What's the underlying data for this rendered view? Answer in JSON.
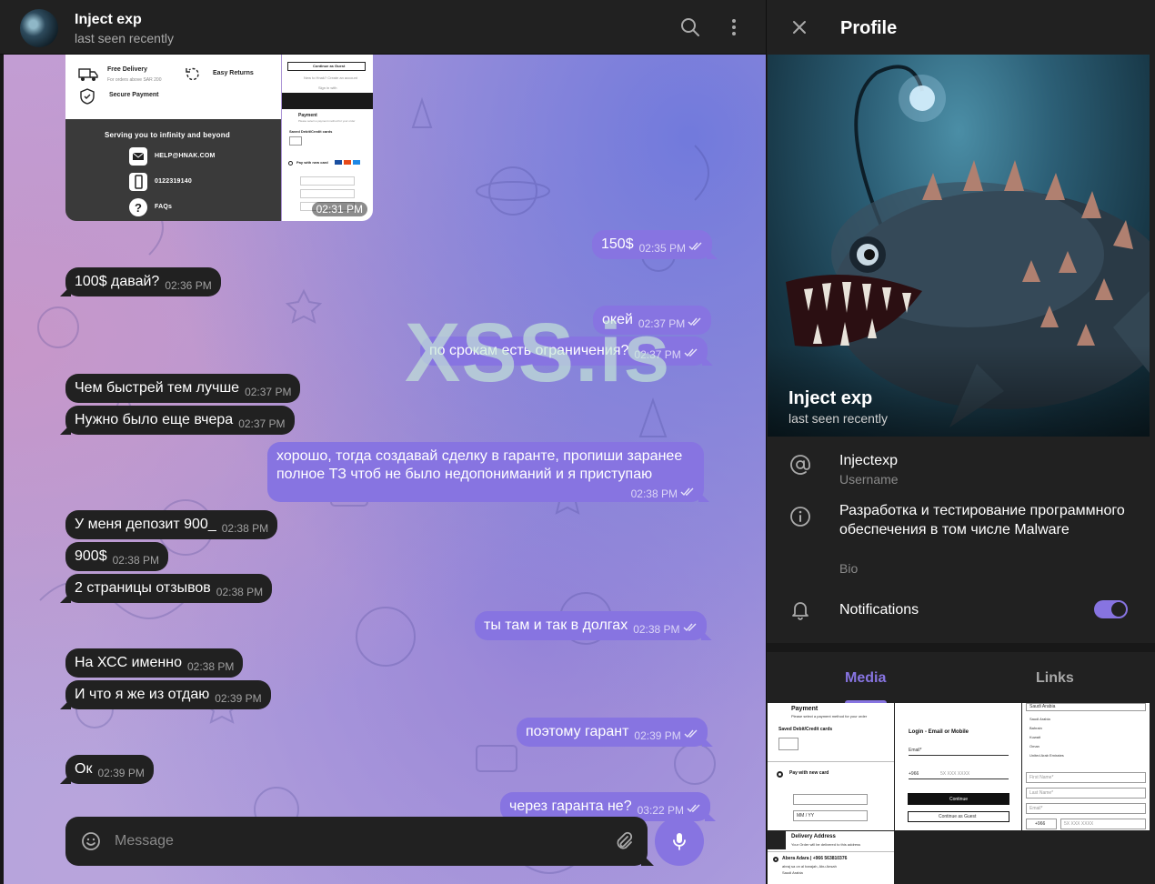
{
  "chat": {
    "title": "Inject exp",
    "status": "last seen recently",
    "watermark": "XSS.is",
    "shared_image": {
      "free_delivery": "Free Delivery",
      "free_delivery_sub": "For orders above SAR 200",
      "easy_returns": "Easy Returns",
      "secure_payment": "Secure Payment",
      "tagline": "Serving you to infinity and beyond",
      "email": "HELP@HNAK.COM",
      "phone": "0122319140",
      "faqs": "FAQs",
      "continue_guest": "Continue as Guest",
      "new_to_hnak": "New to Hnak? Create an account",
      "sign_in": "Sign in with",
      "payment": "Payment",
      "payment_sub": "Please select a payment method for your order",
      "saved_cards": "Saved Debit/Credit cards",
      "pay_new_card": "Pay with new card",
      "time": "02:31 PM"
    },
    "messages": [
      {
        "text": "150$",
        "time": "02:35 PM",
        "dir": "out"
      },
      {
        "text": "100$ давай?",
        "time": "02:36 PM",
        "dir": "in"
      },
      {
        "text": "окей",
        "time": "02:37 PM",
        "dir": "out"
      },
      {
        "text": "по срокам есть ограничения?",
        "time": "02:37 PM",
        "dir": "out"
      },
      {
        "text": "Чем быстрей тем лучше",
        "time": "02:37 PM",
        "dir": "in"
      },
      {
        "text": "Нужно было еще вчера",
        "time": "02:37 PM",
        "dir": "in"
      },
      {
        "text": "хорошо, тогда создавай сделку в гаранте, пропиши заранее полное ТЗ чтоб не было недопониманий и я приступаю",
        "time": "02:38 PM",
        "dir": "out"
      },
      {
        "text": "У меня депозит 900_",
        "time": "02:38 PM",
        "dir": "in"
      },
      {
        "text": "900$",
        "time": "02:38 PM",
        "dir": "in"
      },
      {
        "text": "2 страницы отзывов",
        "time": "02:38 PM",
        "dir": "in"
      },
      {
        "text": "ты там и так в долгах",
        "time": "02:38 PM",
        "dir": "out"
      },
      {
        "text": "На ХСС именно",
        "time": "02:38 PM",
        "dir": "in"
      },
      {
        "text": "И что я же из отдаю",
        "time": "02:39 PM",
        "dir": "in"
      },
      {
        "text": "поэтому гарант",
        "time": "02:39 PM",
        "dir": "out"
      },
      {
        "text": "Ок",
        "time": "02:39 PM",
        "dir": "in"
      },
      {
        "text": "через гаранта не?",
        "time": "03:22 PM",
        "dir": "out"
      }
    ],
    "composer": {
      "placeholder": "Message"
    }
  },
  "profile": {
    "title": "Profile",
    "name": "Inject exp",
    "status": "last seen recently",
    "username": "Injectexp",
    "username_label": "Username",
    "bio": "Разработка и тестирование программного обеспечения в том числе Malware",
    "bio_label": "Bio",
    "notifications_label": "Notifications",
    "notifications_on": true,
    "tabs": [
      "Media",
      "Links"
    ],
    "active_tab": "Media",
    "thumbs": {
      "t1_title": "Payment",
      "t1_sub": "Please select a payment method for your order",
      "t1_saved": "Saved Debit/Credit cards",
      "t1_new": "Pay with new card",
      "t1_mm": "MM / YY",
      "t2_title": "Login - Email or Mobile",
      "t2_email": "Email*",
      "t2_code": "+966",
      "t2_phone": "5X XXX XXXX",
      "t2_continue": "Continue",
      "t2_guest": "Continue as Guest",
      "t3_country": "Saudi Arabia",
      "t3_opts": [
        "Saudi Arabia",
        "Bahrain",
        "Kuwait",
        "Oman",
        "United Arab Emirates"
      ],
      "t3_first": "First Name*",
      "t3_last": "Last Name*",
      "t3_email": "Email*",
      "t3_code": "+966",
      "t3_phone": "5X XXX XXXX",
      "t4_title": "Delivery Address",
      "t4_sub": "Your Order will be delivered to this address",
      "t4_addr": "Abera Adara | +966 563810376",
      "t4_line2": "abraj sa on al barajah, Abu Ansah",
      "t4_line3": "Saudi Arabia"
    }
  },
  "colors": {
    "accent": "#8774e1",
    "bubble_in": "#212121",
    "panel": "#212121"
  }
}
